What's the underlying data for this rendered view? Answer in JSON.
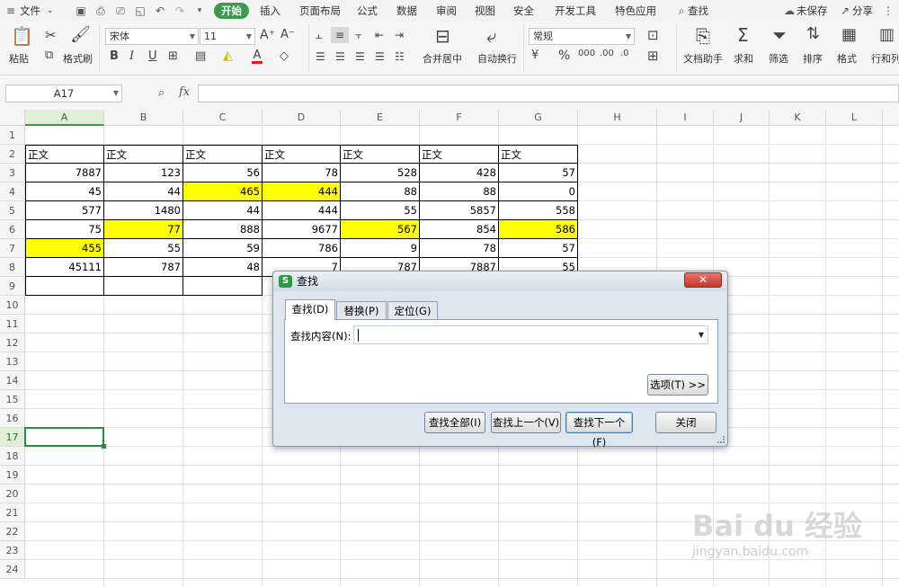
{
  "menubar": {
    "file": "文件",
    "tabs": [
      "开始",
      "插入",
      "页面布局",
      "公式",
      "数据",
      "审阅",
      "视图",
      "安全",
      "开发工具",
      "特色应用"
    ],
    "search": "查找",
    "unsaved": "未保存",
    "share": "分享"
  },
  "ribbon": {
    "paste": "粘贴",
    "format_painter": "格式刷",
    "font_name": "宋体",
    "font_size": "11",
    "merge_center": "合并居中",
    "wrap_text": "自动换行",
    "number_format": "常规",
    "doc_assistant": "文档助手",
    "sum": "求和",
    "filter": "筛选",
    "sort": "排序",
    "format": "格式",
    "rows_cols": "行和列",
    "fx_label": "fx"
  },
  "formula_bar": {
    "name_box": "A17",
    "value": ""
  },
  "sheet": {
    "columns": [
      "A",
      "B",
      "C",
      "D",
      "E",
      "F",
      "G",
      "H",
      "I",
      "J",
      "K",
      "L"
    ],
    "selected_column": "A",
    "rows": [
      "1",
      "2",
      "3",
      "4",
      "5",
      "6",
      "7",
      "8",
      "9",
      "10",
      "11",
      "12",
      "13",
      "14",
      "15",
      "16",
      "17",
      "18",
      "19",
      "20",
      "21",
      "22",
      "23",
      "24"
    ],
    "selected_row": "17",
    "header_row": [
      "正文",
      "正文",
      "正文",
      "正文",
      "正文",
      "正文",
      "正文"
    ],
    "data": [
      [
        "7887",
        "123",
        "56",
        "78",
        "528",
        "428",
        "57"
      ],
      [
        "45",
        "44",
        "465",
        "444",
        "88",
        "88",
        "0"
      ],
      [
        "577",
        "1480",
        "44",
        "444",
        "55",
        "5857",
        "558"
      ],
      [
        "75",
        "77",
        "888",
        "9677",
        "567",
        "854",
        "586"
      ],
      [
        "455",
        "55",
        "59",
        "786",
        "9",
        "78",
        "57"
      ],
      [
        "45111",
        "787",
        "48",
        "7",
        "787",
        "7887",
        "55"
      ]
    ],
    "highlight_color": "#ffff00"
  },
  "dialog": {
    "title": "查找",
    "logo": "S",
    "close": "✕",
    "tabs": [
      "查找(D)",
      "替换(P)",
      "定位(G)"
    ],
    "find_label": "查找内容(N):",
    "find_value": "",
    "options_button": "选项(T) >>",
    "find_all": "查找全部(I)",
    "find_prev": "查找上一个(V)",
    "find_next": "查找下一个(F)",
    "close_button": "关闭"
  },
  "watermark": {
    "logo_text": "Bai du 经验",
    "url": "jingyan.baidu.com"
  },
  "colors": {
    "accent_green": "#3d9a4c",
    "ribbon_bg": "#f5f5f5",
    "close_red": "#c0392b"
  }
}
